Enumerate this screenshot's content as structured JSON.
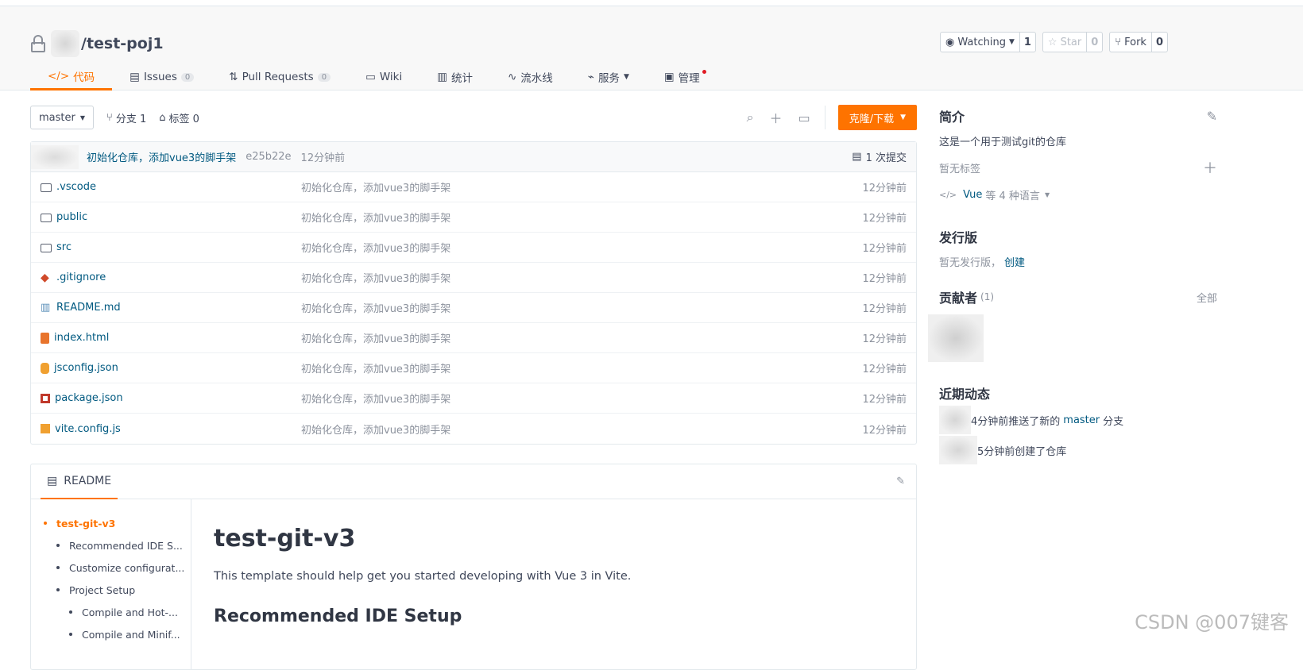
{
  "repo": {
    "name": "/test-poj1"
  },
  "actions": {
    "watch": {
      "label": "Watching",
      "count": "1"
    },
    "star": {
      "label": "Star",
      "count": "0"
    },
    "fork": {
      "label": "Fork",
      "count": "0"
    }
  },
  "tabs": [
    {
      "label": "代码",
      "icon": "code-icon"
    },
    {
      "label": "Issues",
      "badge": "0",
      "icon": "issues-icon"
    },
    {
      "label": "Pull Requests",
      "badge": "0",
      "icon": "pr-icon"
    },
    {
      "label": "Wiki",
      "icon": "wiki-icon"
    },
    {
      "label": "统计",
      "icon": "stats-icon"
    },
    {
      "label": "流水线",
      "icon": "pipeline-icon"
    },
    {
      "label": "服务",
      "icon": "service-icon"
    },
    {
      "label": "管理",
      "icon": "manage-icon"
    }
  ],
  "toolbar": {
    "branch": "master",
    "branches": "分支 1",
    "tags": "标签 0",
    "clone": "克隆/下载"
  },
  "commit": {
    "message": "初始化仓库，添加vue3的脚手架",
    "hash": "e25b22e",
    "time": "12分钟前",
    "count": "1 次提交"
  },
  "files": [
    {
      "name": ".vscode",
      "icon": "folder-icon",
      "msg": "初始化仓库，添加vue3的脚手架",
      "time": "12分钟前"
    },
    {
      "name": "public",
      "icon": "folder-icon",
      "msg": "初始化仓库，添加vue3的脚手架",
      "time": "12分钟前"
    },
    {
      "name": "src",
      "icon": "folder-icon",
      "msg": "初始化仓库，添加vue3的脚手架",
      "time": "12分钟前"
    },
    {
      "name": ".gitignore",
      "icon": "git-icon",
      "msg": "初始化仓库，添加vue3的脚手架",
      "time": "12分钟前"
    },
    {
      "name": "README.md",
      "icon": "book-icon",
      "msg": "初始化仓库，添加vue3的脚手架",
      "time": "12分钟前"
    },
    {
      "name": "index.html",
      "icon": "html-icon",
      "msg": "初始化仓库，添加vue3的脚手架",
      "time": "12分钟前"
    },
    {
      "name": "jsconfig.json",
      "icon": "db-icon",
      "msg": "初始化仓库，添加vue3的脚手架",
      "time": "12分钟前"
    },
    {
      "name": "package.json",
      "icon": "npm-icon",
      "msg": "初始化仓库，添加vue3的脚手架",
      "time": "12分钟前"
    },
    {
      "name": "vite.config.js",
      "icon": "js-icon",
      "msg": "初始化仓库，添加vue3的脚手架",
      "time": "12分钟前"
    }
  ],
  "readme": {
    "tab": "README",
    "toc": [
      "test-git-v3",
      "Recommended IDE S...",
      "Customize configurat...",
      "Project Setup",
      "Compile and Hot-...",
      "Compile and Minif..."
    ],
    "h1": "test-git-v3",
    "p": "This template should help get you started developing with Vue 3 in Vite.",
    "h2": "Recommended IDE Setup"
  },
  "side": {
    "intro_title": "简介",
    "intro_text": "这是一个用于测试git的仓库",
    "no_tags": "暂无标签",
    "lang_link": "Vue",
    "lang_text": "等 4 种语言",
    "release_title": "发行版",
    "no_release": "暂无发行版，",
    "create": "创建",
    "contrib_title": "贡献者",
    "contrib_count": "(1)",
    "all": "全部",
    "activity_title": "近期动态",
    "activity": [
      {
        "pre": "4分钟前推送了新的",
        "link": "master",
        "post": "分支"
      },
      {
        "pre": "5分钟前创建了仓库",
        "link": "",
        "post": ""
      }
    ]
  },
  "watermark": "CSDN @007键客"
}
